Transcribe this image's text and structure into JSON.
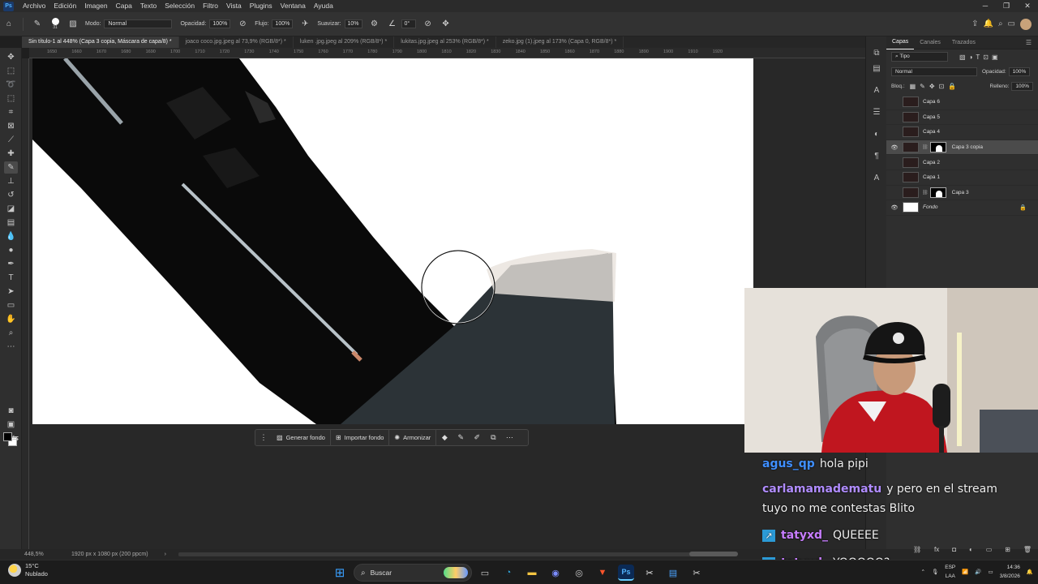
{
  "app": {
    "logo": "Ps"
  },
  "menu": [
    "Archivo",
    "Edición",
    "Imagen",
    "Capa",
    "Texto",
    "Selección",
    "Filtro",
    "Vista",
    "Plugins",
    "Ventana",
    "Ayuda"
  ],
  "options": {
    "brush_size": "31",
    "mode_label": "Modo:",
    "mode_value": "Normal",
    "opacity_label": "Opacidad:",
    "opacity_value": "100%",
    "flow_label": "Flujo:",
    "flow_value": "100%",
    "smooth_label": "Suavizar:",
    "smooth_value": "10%",
    "angle_value": "0°"
  },
  "tabs": [
    {
      "label": "Sin título-1 al 448% (Capa 3 copia, Máscara de capa/8) *"
    },
    {
      "label": "joaco coco.jpg.jpeg al 73,9% (RGB/8*) *"
    },
    {
      "label": "luken .jpg.jpeg al 209% (RGB/8*) *"
    },
    {
      "label": "lukitas.jpg.jpeg al 253% (RGB/8*) *"
    },
    {
      "label": "zeko.jpg (1).jpeg al 173% (Capa 0, RGB/8*) *"
    }
  ],
  "ruler_ticks": [
    "1650",
    "1660",
    "1670",
    "1680",
    "1690",
    "1700",
    "1710",
    "1720",
    "1730",
    "1740",
    "1750",
    "1760",
    "1770",
    "1780",
    "1790",
    "1800",
    "1810",
    "1820",
    "1830",
    "1840",
    "1850",
    "1860",
    "1870",
    "1880",
    "1890",
    "1900",
    "1910",
    "1920"
  ],
  "context_bar": {
    "generate": "Generar fondo",
    "import": "Importar fondo",
    "harmonize": "Armonizar"
  },
  "status": {
    "zoom": "448,5%",
    "dims": "1920 px x 1080 px (200 ppcm)"
  },
  "panel": {
    "tabs": [
      "Capas",
      "Canales",
      "Trazados"
    ],
    "filter": "Tipo",
    "blend": "Normal",
    "opacity_label": "Opacidad:",
    "opacity_value": "100%",
    "lock_label": "Bloq.:",
    "fill_label": "Relleno:",
    "fill_value": "100%"
  },
  "layers": [
    {
      "name": "Capa 6",
      "visible": false,
      "mask": false,
      "selected": false
    },
    {
      "name": "Capa 5",
      "visible": false,
      "mask": false,
      "selected": false
    },
    {
      "name": "Capa 4",
      "visible": false,
      "mask": false,
      "selected": false
    },
    {
      "name": "Capa 3 copia",
      "visible": true,
      "mask": true,
      "selected": true
    },
    {
      "name": "Capa 2",
      "visible": false,
      "mask": false,
      "selected": false
    },
    {
      "name": "Capa 1",
      "visible": false,
      "mask": false,
      "selected": false
    },
    {
      "name": "Capa 3",
      "visible": false,
      "mask": true,
      "selected": false
    },
    {
      "name": "Fondo",
      "visible": true,
      "mask": false,
      "selected": false
    }
  ],
  "chat": [
    {
      "user": "agus_qp",
      "text": "hola pipi",
      "color": "#3f8fff",
      "badge": false
    },
    {
      "user": "carlamamadematu",
      "text": "y pero en el stream",
      "cont": "tuyo no me contestas Blito",
      "color": "#b08cff",
      "badge": false
    },
    {
      "user": "tatyxd_",
      "text": "QUEEEE",
      "color": "#c77dff",
      "badge": true
    },
    {
      "user": "tatyxd_",
      "text": "YOOOOO?",
      "color": "#c77dff",
      "badge": true
    }
  ],
  "taskbar": {
    "temp": "15°C",
    "weather": "Nublado",
    "search": "Buscar",
    "lang1": "ESP",
    "lang2": "LAA",
    "time": "14:36",
    "date": "3/8/2026"
  }
}
